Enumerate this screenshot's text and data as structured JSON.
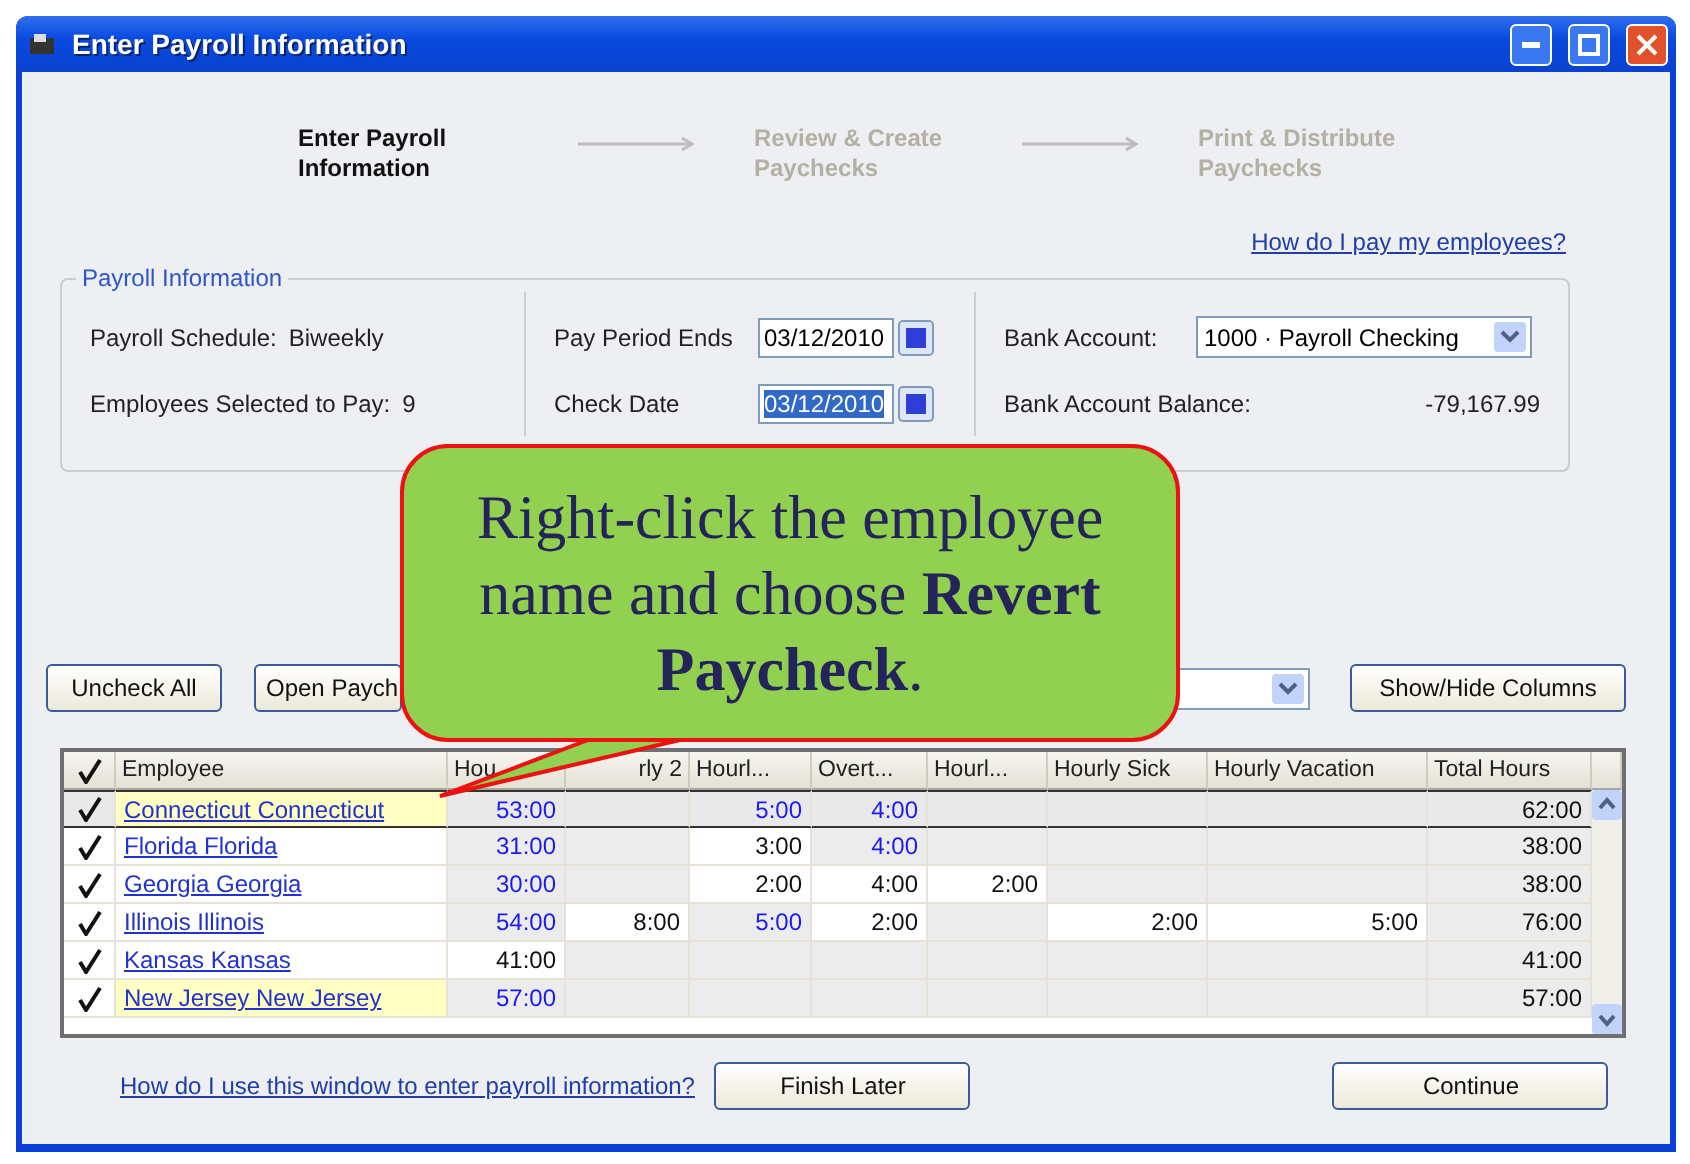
{
  "window": {
    "title": "Enter Payroll Information"
  },
  "steps": [
    {
      "label": "Enter Payroll Information",
      "current": true
    },
    {
      "label": "Review & Create Paychecks",
      "current": false
    },
    {
      "label": "Print & Distribute Paychecks",
      "current": false
    }
  ],
  "help_link": "How do I pay my employees?",
  "payroll_info": {
    "legend": "Payroll Information",
    "schedule_label": "Payroll Schedule:",
    "schedule_value": "Biweekly",
    "selected_label": "Employees Selected to Pay:",
    "selected_value": "9",
    "period_label": "Pay Period Ends",
    "period_value": "03/12/2010",
    "check_label": "Check Date",
    "check_value": "03/12/2010",
    "bank_label": "Bank Account:",
    "bank_value": "1000 · Payroll Checking",
    "balance_label": "Bank Account Balance:",
    "balance_value": "-79,167.99"
  },
  "toolbar": {
    "uncheck": "Uncheck All",
    "open": "Open Paych",
    "show_hide": "Show/Hide Columns"
  },
  "table": {
    "employee_header": "Employee",
    "columns": [
      "Hou",
      "rly 2",
      "Hourl...",
      "Overt...",
      "Hourl...",
      "Hourly Sick",
      "Hourly Vacation",
      "Total Hours"
    ],
    "rows": [
      {
        "checked": true,
        "selected": true,
        "marked": true,
        "employee": "Connecticut Connecticut",
        "cells": [
          {
            "text": "53:00",
            "highlighted": true
          },
          null,
          {
            "text": "5:00",
            "highlighted": true
          },
          {
            "text": "4:00",
            "highlighted": true
          },
          null,
          null,
          null,
          {
            "text": "62:00",
            "highlighted": false
          }
        ]
      },
      {
        "checked": true,
        "selected": false,
        "marked": false,
        "employee": "Florida Florida",
        "cells": [
          {
            "text": "31:00",
            "highlighted": true
          },
          null,
          {
            "text": "3:00",
            "highlighted": false
          },
          {
            "text": "4:00",
            "highlighted": true
          },
          null,
          null,
          null,
          {
            "text": "38:00",
            "highlighted": false
          }
        ]
      },
      {
        "checked": true,
        "selected": false,
        "marked": false,
        "employee": "Georgia Georgia",
        "cells": [
          {
            "text": "30:00",
            "highlighted": true
          },
          null,
          {
            "text": "2:00",
            "highlighted": false
          },
          {
            "text": "4:00",
            "highlighted": false
          },
          {
            "text": "2:00",
            "highlighted": false
          },
          null,
          null,
          {
            "text": "38:00",
            "highlighted": false
          }
        ]
      },
      {
        "checked": true,
        "selected": false,
        "marked": false,
        "employee": "Illinois Illinois",
        "cells": [
          {
            "text": "54:00",
            "highlighted": true
          },
          {
            "text": "8:00",
            "highlighted": false
          },
          {
            "text": "5:00",
            "highlighted": true
          },
          {
            "text": "2:00",
            "highlighted": false
          },
          null,
          {
            "text": "2:00",
            "highlighted": false
          },
          {
            "text": "5:00",
            "highlighted": false
          },
          {
            "text": "76:00",
            "highlighted": false
          }
        ]
      },
      {
        "checked": true,
        "selected": false,
        "marked": false,
        "employee": "Kansas Kansas",
        "cells": [
          {
            "text": "41:00",
            "highlighted": false
          },
          null,
          null,
          null,
          null,
          null,
          null,
          {
            "text": "41:00",
            "highlighted": false
          }
        ]
      },
      {
        "checked": true,
        "selected": false,
        "marked": true,
        "employee": "New Jersey New Jersey",
        "cells": [
          {
            "text": "57:00",
            "highlighted": true
          },
          null,
          null,
          null,
          null,
          null,
          null,
          {
            "text": "57:00",
            "highlighted": false
          }
        ]
      }
    ]
  },
  "footer": {
    "help_link": "How do I use this window to enter payroll information?",
    "finish": "Finish Later",
    "continue": "Continue"
  },
  "callout": {
    "text": "Right-click the employee name and choose **Revert Paycheck**."
  }
}
